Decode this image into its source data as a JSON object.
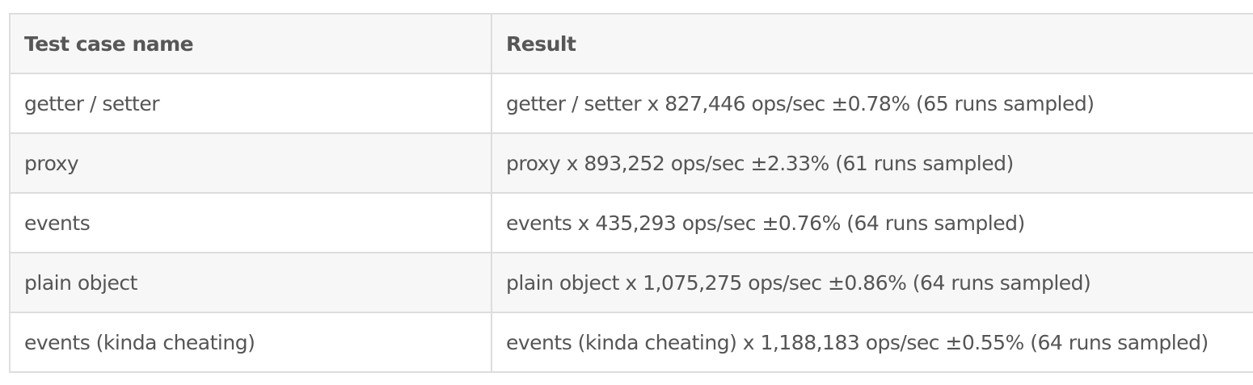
{
  "table": {
    "headers": {
      "name": "Test case name",
      "result": "Result"
    },
    "rows": [
      {
        "name": "getter / setter",
        "result": "getter / setter x 827,446 ops/sec ±0.78% (65 runs sampled)"
      },
      {
        "name": "proxy",
        "result": "proxy x 893,252 ops/sec ±2.33% (61 runs sampled)"
      },
      {
        "name": "events",
        "result": "events x 435,293 ops/sec ±0.76% (64 runs sampled)"
      },
      {
        "name": "plain object",
        "result": "plain object x 1,075,275 ops/sec ±0.86% (64 runs sampled)"
      },
      {
        "name": "events (kinda cheating)",
        "result": "events (kinda cheating) x 1,188,183 ops/sec ±0.55% (64 runs sampled)"
      }
    ]
  }
}
